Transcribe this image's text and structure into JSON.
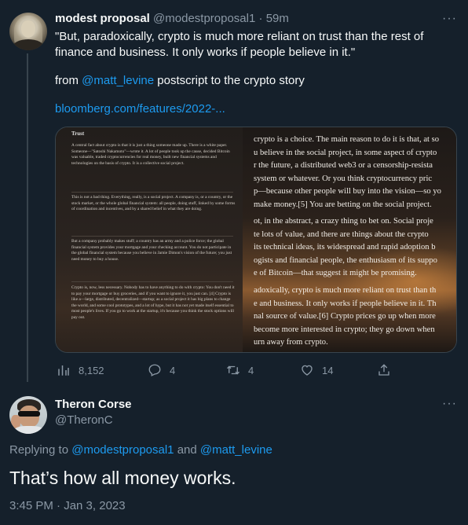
{
  "tweet1": {
    "author_name": "modest proposal",
    "author_handle": "@modestproposal1",
    "separator": "·",
    "time": "59m",
    "more_icon": "more-horizontal-icon",
    "text_line1": "\"But, paradoxically, crypto is much more reliant on trust than the rest of finance and business. It only works if people believe in it.\"",
    "text_from": "from ",
    "mention": "@matt_levine",
    "text_after_mention": " postscript to the crypto story",
    "url": "bloomberg.com/features/2022-...",
    "media": {
      "left_title": "Trust",
      "left_paragraphs": [
        "A central fact about crypto is that it is just a thing someone made up. There is a white paper. Someone—\"Satoshi Nakamoto\"—wrote it. A lot of people took up the cause, decided Bitcoin was valuable, traded cryptocurrencies for real money, built new financial systems and technologies on the basis of crypto. It is a collective social project.",
        "This is not a bad thing. Everything, really, is a social project. A company is, or a country, or the stock market, or the whole global financial system: all people, doing stuff, linked by some forms of coordination and incentives, and by a shared belief in what they are doing.",
        "But a company probably makes stuff; a country has an army and a police force; the global financial system provides your mortgage and your checking account. You do not participate in the global financial system because you believe in Jamie Dimon's vision of the future; you just need money to buy a house.",
        "Crypto is, now, less necessary. Nobody has to have anything to do with crypto: You don't need it to pay your mortgage or buy groceries, and if you want to ignore it, you just can. [4] Crypto is like a—large, distributed, decentralized—startup; as a social project it has big plans to change the world, and some cool prototypes, and a lot of hype, but it has not yet made itself essential to most people's lives. If you go to work at the startup, it's because you think the stock options will pay out."
      ],
      "right_paragraphs": [
        [
          "crypto is a choice. The main reason to do it is that, at so",
          "u believe in the social project, in some aspect of crypto",
          "r the future, a distributed web3 or a censorship-resista",
          " system or whatever. Or you think cryptocurrency pric",
          "p—because other people will buy into the vision—so yo",
          "make money.[5] You are betting on the social project."
        ],
        [
          "ot, in the abstract, a crazy thing to bet on. Social proje",
          "te lots of value, and there are things about the crypto",
          "its technical ideas, its widespread and rapid adoption b",
          "ogists and financial people, the enthusiasm of its suppo",
          "e of Bitcoin—that suggest it might be promising."
        ],
        [
          "adoxically, crypto is much more reliant on trust than th",
          "e and business. It only works if people believe in it. Th",
          "nal source of value.[6] Crypto prices go up when more",
          "become more interested in crypto; they go down when",
          "urn away from crypto."
        ]
      ]
    },
    "actions": {
      "views": "8,152",
      "replies": "4",
      "retweets": "4",
      "likes": "14"
    }
  },
  "tweet2": {
    "author_name": "Theron Corse",
    "author_handle": "@TheronC",
    "replying_prefix": "Replying to ",
    "replying_mention1": "@modestproposal1",
    "replying_and": " and ",
    "replying_mention2": "@matt_levine",
    "text": "That’s how all money works.",
    "timestamp": "3:45 PM · Jan 3, 2023"
  }
}
